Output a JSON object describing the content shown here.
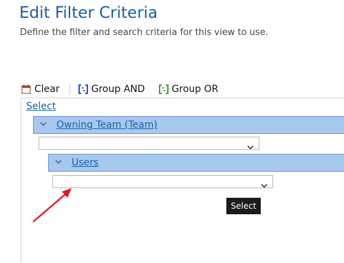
{
  "header": {
    "title": "Edit Filter Criteria",
    "subtitle": "Define the filter and search criteria for this view to use."
  },
  "toolbar": {
    "clear_label": "Clear",
    "group_and_label": "Group AND",
    "group_or_label": "Group OR",
    "icons": {
      "clear": "clear-icon",
      "group_and": "group-and-icon",
      "group_or": "group-or-icon"
    }
  },
  "filter": {
    "select_label": "Select",
    "groups": [
      {
        "label": "Owning Team (Team)",
        "dropdown_value": ""
      },
      {
        "label": "Users",
        "dropdown_value": ""
      }
    ]
  },
  "tooltip": {
    "text": "Select"
  },
  "colors": {
    "title": "#1560a8",
    "link": "#1560a8",
    "group_header_bg": "#a9c8ef",
    "annotation_arrow": "#e81123",
    "group_and_icon": "#1e5bbf",
    "group_or_icon": "#3ea52b"
  }
}
